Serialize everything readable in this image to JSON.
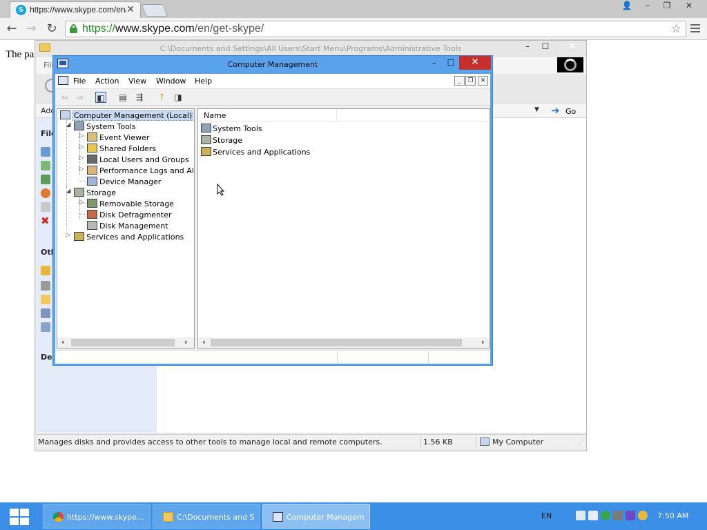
{
  "browser": {
    "tab_title": "https://www.skype.com/en/",
    "tab_favicon_letter": "S",
    "url_scheme": "https://",
    "url_host": "www.skype.com",
    "url_path": "/en/get-skype/",
    "page_text": "The pa"
  },
  "explorer": {
    "title": "C:\\Documents and Settings\\All Users\\Start Menu\\Programs\\Administrative Tools",
    "menu_first": "File",
    "address_label": "Add",
    "go_label": "Go",
    "task_headers": [
      "File",
      "Oth",
      "Det"
    ],
    "status_message": "Manages disks and provides access to other tools to manage local and remote computers.",
    "status_size": "1.56 KB",
    "status_location": "My Computer"
  },
  "computer_management": {
    "title": "Computer Management",
    "menu": [
      "File",
      "Action",
      "View",
      "Window",
      "Help"
    ],
    "tree": {
      "root": "Computer Management (Local)",
      "system_tools": "System Tools",
      "event_viewer": "Event Viewer",
      "shared_folders": "Shared Folders",
      "local_users": "Local Users and Groups",
      "perf_logs": "Performance Logs and Alert",
      "device_manager": "Device Manager",
      "storage": "Storage",
      "removable_storage": "Removable Storage",
      "disk_defrag": "Disk Defragmenter",
      "disk_mgmt": "Disk Management",
      "services_apps": "Services and Applications"
    },
    "column_name": "Name",
    "items": [
      "System Tools",
      "Storage",
      "Services and Applications"
    ]
  },
  "taskbar": {
    "tasks": [
      "https://www.skype....",
      "C:\\Documents and S...",
      "Computer Managem..."
    ],
    "language": "EN",
    "clock": "7:50 AM"
  },
  "colors": {
    "taskbar": "#3b8fe6",
    "cm_frame": "#5aa2ec",
    "close_red": "#c7302a"
  }
}
